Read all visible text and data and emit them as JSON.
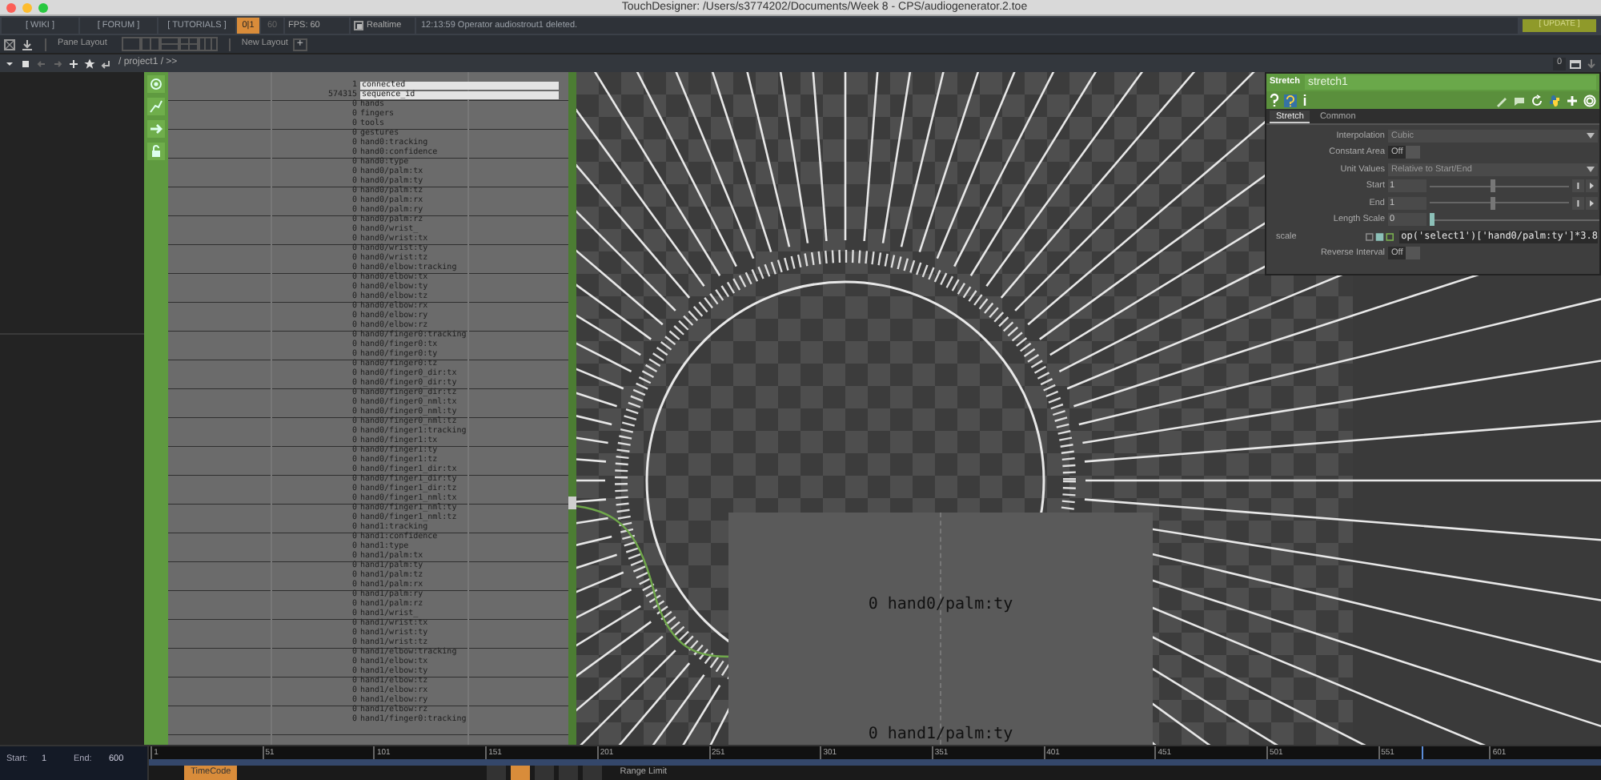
{
  "window": {
    "title": "TouchDesigner: /Users/s3774202/Documents/Week 8 - CPS/audiogenerator.2.toe"
  },
  "toolbar": {
    "links": [
      "[ WIKI ]",
      "[ FORUM ]",
      "[ TUTORIALS ]"
    ],
    "frame_toggle": "0|1",
    "fps_target": "60",
    "fps": "FPS:  60",
    "realtime": {
      "label": "Realtime",
      "checked": true
    },
    "message": "12:13:59 Operator audiostrout1 deleted.",
    "update_button": "[ UPDATE ]"
  },
  "pane_bar": {
    "label": "Pane Layout",
    "new_layout": "New Layout",
    "add": "+"
  },
  "path_bar": {
    "path": "/ project1 / >>",
    "counter": "0"
  },
  "channel_list": {
    "rows": [
      {
        "value": "1",
        "name": "connected",
        "highlighted": true
      },
      {
        "value": "574315",
        "name": "sequence_id",
        "highlighted": true
      },
      {
        "value": "0",
        "name": "hands",
        "highlighted": false
      },
      {
        "value": "0",
        "name": "fingers",
        "highlighted": false
      },
      {
        "value": "0",
        "name": "tools",
        "highlighted": false
      },
      {
        "value": "0",
        "name": "gestures",
        "highlighted": false
      },
      {
        "value": "0",
        "name": "hand0:tracking",
        "highlighted": false
      },
      {
        "value": "0",
        "name": "hand0:confidence",
        "highlighted": false
      },
      {
        "value": "0",
        "name": "hand0:type",
        "highlighted": false
      },
      {
        "value": "0",
        "name": "hand0/palm:tx",
        "highlighted": false
      },
      {
        "value": "0",
        "name": "hand0/palm:ty",
        "highlighted": false
      },
      {
        "value": "0",
        "name": "hand0/palm:tz",
        "highlighted": false
      },
      {
        "value": "0",
        "name": "hand0/palm:rx",
        "highlighted": false
      },
      {
        "value": "0",
        "name": "hand0/palm:ry",
        "highlighted": false
      },
      {
        "value": "0",
        "name": "hand0/palm:rz",
        "highlighted": false
      },
      {
        "value": "0",
        "name": "hand0/wrist_",
        "highlighted": false
      },
      {
        "value": "0",
        "name": "hand0/wrist:tx",
        "highlighted": false
      },
      {
        "value": "0",
        "name": "hand0/wrist:ty",
        "highlighted": false
      },
      {
        "value": "0",
        "name": "hand0/wrist:tz",
        "highlighted": false
      },
      {
        "value": "0",
        "name": "hand0/elbow:tracking",
        "highlighted": false
      },
      {
        "value": "0",
        "name": "hand0/elbow:tx",
        "highlighted": false
      },
      {
        "value": "0",
        "name": "hand0/elbow:ty",
        "highlighted": false
      },
      {
        "value": "0",
        "name": "hand0/elbow:tz",
        "highlighted": false
      },
      {
        "value": "0",
        "name": "hand0/elbow:rx",
        "highlighted": false
      },
      {
        "value": "0",
        "name": "hand0/elbow:ry",
        "highlighted": false
      },
      {
        "value": "0",
        "name": "hand0/elbow:rz",
        "highlighted": false
      },
      {
        "value": "0",
        "name": "hand0/finger0:tracking",
        "highlighted": false
      },
      {
        "value": "0",
        "name": "hand0/finger0:tx",
        "highlighted": false
      },
      {
        "value": "0",
        "name": "hand0/finger0:ty",
        "highlighted": false
      },
      {
        "value": "0",
        "name": "hand0/finger0:tz",
        "highlighted": false
      },
      {
        "value": "0",
        "name": "hand0/finger0_dir:tx",
        "highlighted": false
      },
      {
        "value": "0",
        "name": "hand0/finger0_dir:ty",
        "highlighted": false
      },
      {
        "value": "0",
        "name": "hand0/finger0_dir:tz",
        "highlighted": false
      },
      {
        "value": "0",
        "name": "hand0/finger0_nml:tx",
        "highlighted": false
      },
      {
        "value": "0",
        "name": "hand0/finger0_nml:ty",
        "highlighted": false
      },
      {
        "value": "0",
        "name": "hand0/finger0_nml:tz",
        "highlighted": false
      },
      {
        "value": "0",
        "name": "hand0/finger1:tracking",
        "highlighted": false
      },
      {
        "value": "0",
        "name": "hand0/finger1:tx",
        "highlighted": false
      },
      {
        "value": "0",
        "name": "hand0/finger1:ty",
        "highlighted": false
      },
      {
        "value": "0",
        "name": "hand0/finger1:tz",
        "highlighted": false
      },
      {
        "value": "0",
        "name": "hand0/finger1_dir:tx",
        "highlighted": false
      },
      {
        "value": "0",
        "name": "hand0/finger1_dir:ty",
        "highlighted": false
      },
      {
        "value": "0",
        "name": "hand0/finger1_dir:tz",
        "highlighted": false
      },
      {
        "value": "0",
        "name": "hand0/finger1_nml:tx",
        "highlighted": false
      },
      {
        "value": "0",
        "name": "hand0/finger1_nml:ty",
        "highlighted": false
      },
      {
        "value": "0",
        "name": "hand0/finger1_nml:tz",
        "highlighted": false
      },
      {
        "value": "0",
        "name": "hand1:tracking",
        "highlighted": false
      },
      {
        "value": "0",
        "name": "hand1:confidence",
        "highlighted": false
      },
      {
        "value": "0",
        "name": "hand1:type",
        "highlighted": false
      },
      {
        "value": "0",
        "name": "hand1/palm:tx",
        "highlighted": false
      },
      {
        "value": "0",
        "name": "hand1/palm:ty",
        "highlighted": false
      },
      {
        "value": "0",
        "name": "hand1/palm:tz",
        "highlighted": false
      },
      {
        "value": "0",
        "name": "hand1/palm:rx",
        "highlighted": false
      },
      {
        "value": "0",
        "name": "hand1/palm:ry",
        "highlighted": false
      },
      {
        "value": "0",
        "name": "hand1/palm:rz",
        "highlighted": false
      },
      {
        "value": "0",
        "name": "hand1/wrist_",
        "highlighted": false
      },
      {
        "value": "0",
        "name": "hand1/wrist:tx",
        "highlighted": false
      },
      {
        "value": "0",
        "name": "hand1/wrist:ty",
        "highlighted": false
      },
      {
        "value": "0",
        "name": "hand1/wrist:tz",
        "highlighted": false
      },
      {
        "value": "0",
        "name": "hand1/elbow:tracking",
        "highlighted": false
      },
      {
        "value": "0",
        "name": "hand1/elbow:tx",
        "highlighted": false
      },
      {
        "value": "0",
        "name": "hand1/elbow:ty",
        "highlighted": false
      },
      {
        "value": "0",
        "name": "hand1/elbow:tz",
        "highlighted": false
      },
      {
        "value": "0",
        "name": "hand1/elbow:rx",
        "highlighted": false
      },
      {
        "value": "0",
        "name": "hand1/elbow:ry",
        "highlighted": false
      },
      {
        "value": "0",
        "name": "hand1/elbow:rz",
        "highlighted": false
      },
      {
        "value": "0",
        "name": "hand1/finger0:tracking",
        "highlighted": false
      }
    ]
  },
  "viewer": {
    "labels": [
      "0 hand0/palm:ty",
      "0 hand1/palm:ty"
    ]
  },
  "parameters": {
    "type": "Stretch",
    "name": "stretch1",
    "tabs": [
      {
        "label": "Stretch",
        "selected": true
      },
      {
        "label": "Common",
        "selected": false
      }
    ],
    "rows": [
      {
        "kind": "menu",
        "label": "Interpolation",
        "value": "Cubic"
      },
      {
        "kind": "toggle",
        "label": "Constant Area",
        "value": "Off",
        "on": false
      },
      {
        "kind": "menu",
        "label": "Unit Values",
        "value": "Relative to Start/End"
      },
      {
        "kind": "slider",
        "label": "Start",
        "value": "1",
        "level": 0.45,
        "stepper": true
      },
      {
        "kind": "slider",
        "label": "End",
        "value": "1",
        "level": 0.45,
        "stepper": true
      },
      {
        "kind": "slider",
        "label": "Length Scale",
        "value": "0",
        "level": 0,
        "stepper": false
      },
      {
        "kind": "expression",
        "label": "scale",
        "value": "op('select1')['hand0/palm:ty']*3.8"
      },
      {
        "kind": "toggle",
        "label": "Reverse Interval",
        "value": "Off",
        "on": false
      }
    ]
  },
  "timeline": {
    "start_label": "Start:",
    "start": "1",
    "end_label": "End:",
    "end": "600",
    "ticks": [
      "1",
      "51",
      "101",
      "151",
      "201",
      "251",
      "301",
      "351",
      "401",
      "451",
      "501",
      "551",
      "601"
    ],
    "playhead": {
      "level": 0.877
    },
    "timecode_button": "TimeCode",
    "range_limit": "Range Limit"
  }
}
